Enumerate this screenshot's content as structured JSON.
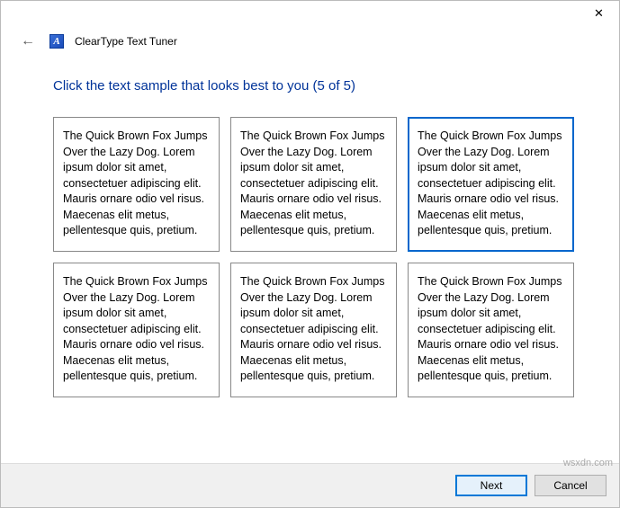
{
  "window": {
    "close_label": "✕"
  },
  "header": {
    "back_arrow": "←",
    "app_icon_letter": "A",
    "app_title": "ClearType Text Tuner"
  },
  "heading": "Click the text sample that looks best to you (5 of 5)",
  "sample_text": "The Quick Brown Fox Jumps Over the Lazy Dog. Lorem ipsum dolor sit amet, consectetuer adipiscing elit. Mauris ornare odio vel risus. Maecenas elit metus, pellentesque quis, pretium.",
  "samples": [
    {
      "selected": false
    },
    {
      "selected": false
    },
    {
      "selected": true
    },
    {
      "selected": false
    },
    {
      "selected": false
    },
    {
      "selected": false
    }
  ],
  "footer": {
    "next_label": "Next",
    "cancel_label": "Cancel"
  },
  "watermark": "wsxdn.com"
}
